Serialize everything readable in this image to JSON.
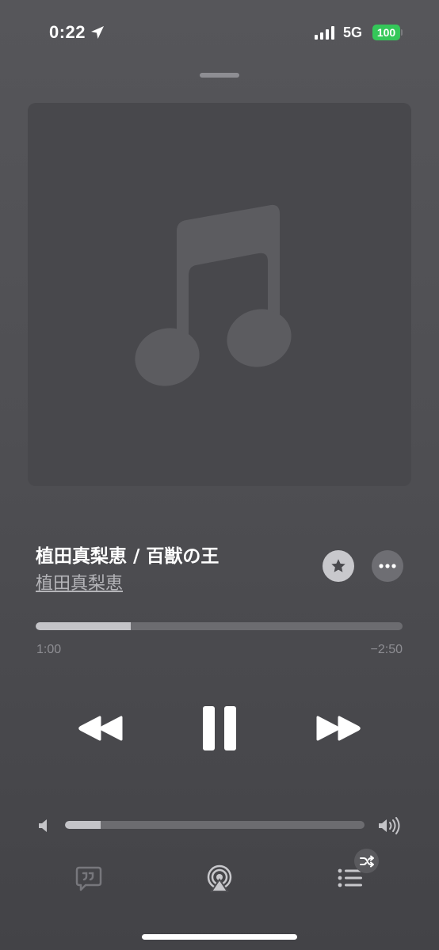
{
  "status_bar": {
    "time": "0:22",
    "network": "5G",
    "battery": "100",
    "battery_color": "#34c759"
  },
  "now_playing": {
    "title": "植田真梨恵 / 百獣の王",
    "artist": "植田真梨恵",
    "artwork_icon": "music-note-icon",
    "favorite_icon": "star-icon",
    "more_icon": "ellipsis-icon"
  },
  "progress": {
    "elapsed": "1:00",
    "remaining": "−2:50",
    "fraction": 0.26
  },
  "controls": {
    "previous_icon": "backward-icon",
    "play_pause_icon": "pause-icon",
    "next_icon": "forward-icon"
  },
  "volume": {
    "level": 0.12,
    "low_icon": "speaker-low-icon",
    "high_icon": "speaker-high-icon"
  },
  "bottom_bar": {
    "lyrics_icon": "lyrics-icon",
    "airplay_icon": "airplay-icon",
    "queue_icon": "queue-icon",
    "shuffle_icon": "shuffle-icon"
  }
}
